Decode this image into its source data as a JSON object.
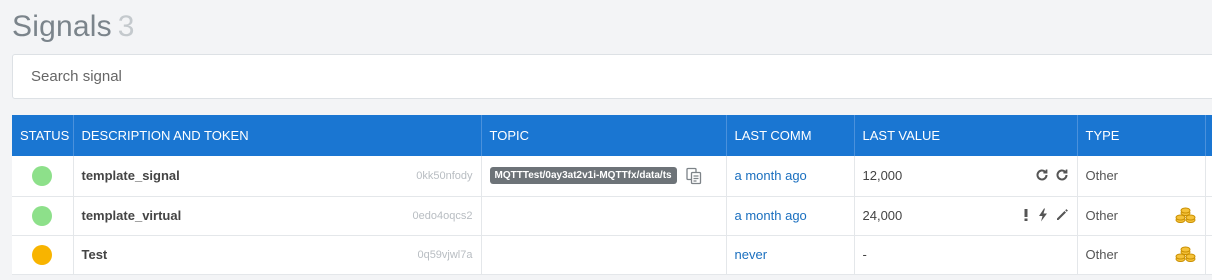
{
  "header": {
    "title": "Signals",
    "count": "3"
  },
  "search": {
    "placeholder": "Search signal"
  },
  "table": {
    "columns": [
      "STATUS",
      "DESCRIPTION AND TOKEN",
      "TOPIC",
      "LAST COMM",
      "LAST VALUE",
      "TYPE"
    ],
    "rows": [
      {
        "status_color": "#8de08a",
        "name": "template_signal",
        "token": "0kk50nfody",
        "topic": "MQTTTest/0ay3at2v1i-MQTTfx/data/ts",
        "last_comm": "a month ago",
        "last_value": "12,000",
        "type": "Other"
      },
      {
        "status_color": "#8de08a",
        "name": "template_virtual",
        "token": "0edo4oqcs2",
        "topic": "",
        "last_comm": "a month ago",
        "last_value": "24,000",
        "type": "Other"
      },
      {
        "status_color": "#f8b400",
        "name": "Test",
        "token": "0q59vjwl7a",
        "topic": "",
        "last_comm": "never",
        "last_value": "-",
        "type": "Other"
      }
    ]
  },
  "icons": {
    "copy": "copy-icon",
    "refresh": "refresh-icon",
    "retry": "retry-icon",
    "alert": "exclamation-icon",
    "bolt": "bolt-icon",
    "edit": "pencil-icon",
    "coins": "coins-icon"
  },
  "colors": {
    "header_bg": "#1a76d2",
    "online": "#8de08a",
    "warning": "#f8b400",
    "link": "#1a6fbf",
    "coins": "#f0b400"
  }
}
